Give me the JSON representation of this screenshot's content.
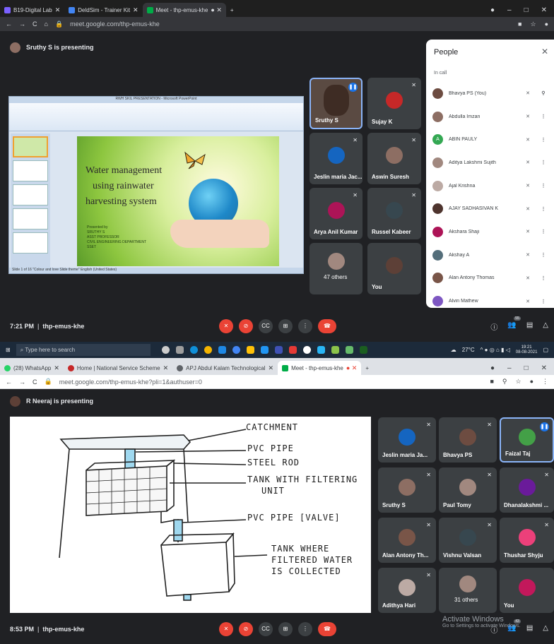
{
  "shot1": {
    "tabs": [
      {
        "label": "B19-Digital Lab",
        "active": false
      },
      {
        "label": "DeldSim - Trainer Kit",
        "active": false
      },
      {
        "label": "Meet - thp-emus-khe",
        "active": true
      }
    ],
    "url": "meet.google.com/thp-emus-khe",
    "banner": "Sruthy S is presenting",
    "ppt": {
      "window_title": "RWH SKIL PRESENTATION - Microsoft PowerPoint",
      "slide_title": [
        "Water management",
        "using rainwater",
        "harvesting system"
      ],
      "presented_by": [
        "Presented by",
        "SRUTHY S",
        "ASST PROFESSOR",
        "CIVIL ENGINEERING DEPARTMENT",
        "SSET"
      ],
      "status": "Slide 1 of 16   \"Colour and love Slide theme\"   English (United States)"
    },
    "tiles": [
      {
        "name": "Sruthy S",
        "speaking": true,
        "color": "#6d4c41"
      },
      {
        "name": "Sujay K",
        "speaking": false,
        "color": "#c62828"
      },
      {
        "name": "Jeslin maria Jac...",
        "speaking": false,
        "color": "#1565c0"
      },
      {
        "name": "Aswin Suresh",
        "speaking": false,
        "color": "#8d6e63"
      },
      {
        "name": "Arya Anil Kumar",
        "speaking": false,
        "color": "#ad1457"
      },
      {
        "name": "Russel Kabeer",
        "speaking": false,
        "color": "#37474f"
      },
      {
        "name": "47 others",
        "speaking": false,
        "color": "#a1887f"
      },
      {
        "name": "You",
        "speaking": false,
        "color": "#5d4037"
      }
    ],
    "people_panel": {
      "title": "People",
      "section": "In call",
      "people": [
        {
          "name": "Bhavya PS (You)",
          "initial": "",
          "color": "#6d4c41"
        },
        {
          "name": "Abdulla Imzan",
          "initial": "",
          "color": "#8d6e63"
        },
        {
          "name": "ABIN PAULY",
          "initial": "A",
          "color": "#34a853"
        },
        {
          "name": "Aditya Lakshmi Sujith",
          "initial": "",
          "color": "#a1887f"
        },
        {
          "name": "Ajal Krishna",
          "initial": "",
          "color": "#bcaaa4"
        },
        {
          "name": "AJAY SADHASIVAN K",
          "initial": "",
          "color": "#4e342e"
        },
        {
          "name": "Akshara Shaji",
          "initial": "",
          "color": "#ad1457"
        },
        {
          "name": "Akshay A",
          "initial": "",
          "color": "#546e7a"
        },
        {
          "name": "Alan Antony Thomas",
          "initial": "",
          "color": "#795548"
        },
        {
          "name": "Alvin Mathew",
          "initial": "",
          "color": "#7e57c2"
        }
      ]
    },
    "meeting": {
      "time": "7:21 PM",
      "code": "thp-emus-khe",
      "participants_badge": "55"
    },
    "taskbar": {
      "search_placeholder": "Type here to search",
      "weather": "27°C",
      "time": "19:21",
      "date": "08-08-2021"
    }
  },
  "shot2": {
    "tabs": [
      {
        "label": "(28) WhatsApp",
        "active": false
      },
      {
        "label": "Home | National Service Scheme",
        "active": false
      },
      {
        "label": "APJ Abdul Kalam Technological",
        "active": false
      },
      {
        "label": "Meet - thp-emus-khe",
        "active": true
      }
    ],
    "url": "meet.google.com/thp-emus-khe?pli=1&authuser=0",
    "banner": "R Neeraj is presenting",
    "drawing_labels": {
      "catchment": "CATCHMENT",
      "pvc_pipe": "PVC PIPE",
      "steel_rod": "STEEL ROD",
      "tank_filter_1": "TANK WITH FILTERING",
      "tank_filter_2": "UNIT",
      "pvc_valve": "PVC PIPE [VALVE]",
      "tank_filtered_1": "TANK WHERE",
      "tank_filtered_2": "FILTERED WATER",
      "tank_filtered_3": "IS COLLECTED"
    },
    "tiles": [
      {
        "name": "Jeslin maria Ja...",
        "speaking": false,
        "color": "#1565c0"
      },
      {
        "name": "Bhavya PS",
        "speaking": false,
        "color": "#6d4c41"
      },
      {
        "name": "Faizal Taj",
        "speaking": true,
        "color": "#43a047"
      },
      {
        "name": "Sruthy S",
        "speaking": false,
        "color": "#8d6e63"
      },
      {
        "name": "Paul Tomy",
        "speaking": false,
        "color": "#a1887f"
      },
      {
        "name": "Dhanalakshmi ...",
        "speaking": false,
        "color": "#6a1b9a"
      },
      {
        "name": "Alan Antony Th...",
        "speaking": false,
        "color": "#795548"
      },
      {
        "name": "Vishnu Valsan",
        "speaking": false,
        "color": "#37474f"
      },
      {
        "name": "Thushar Shyju",
        "speaking": false,
        "color": "#ec407a"
      },
      {
        "name": "Adithya Hari",
        "speaking": false,
        "color": "#bcaaa4"
      },
      {
        "name": "31 others",
        "speaking": false,
        "color": "#a1887f"
      },
      {
        "name": "You",
        "speaking": false,
        "color": "#c2185b"
      }
    ],
    "meeting": {
      "time": "8:53 PM",
      "code": "thp-emus-khe",
      "participants_badge": "43"
    },
    "watermark": {
      "title": "Activate Windows",
      "subtitle": "Go to Settings to activate Windows."
    }
  }
}
